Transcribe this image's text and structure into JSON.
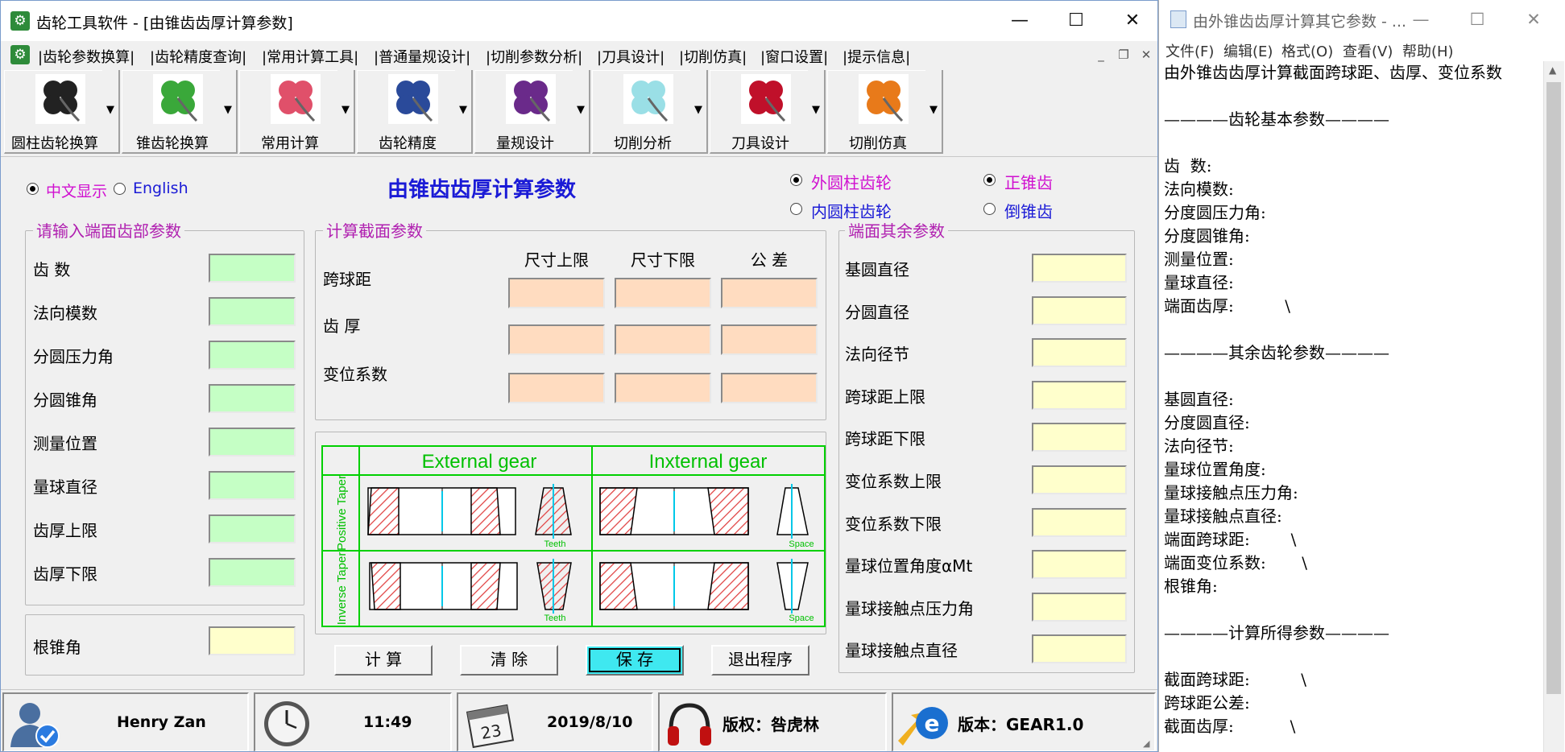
{
  "app": {
    "title": "齿轮工具软件 - [由锥齿齿厚计算参数]",
    "menu": [
      "|齿轮参数换算|",
      "|齿轮精度查询|",
      "|常用计算工具|",
      "|普通量规设计|",
      "|切削参数分析|",
      "|刀具设计|",
      "|切削仿真|",
      "|窗口设置|",
      "|提示信息|"
    ],
    "toolbar": [
      {
        "label": "圆柱齿轮换算",
        "icon": "clover-icon",
        "color": "#222222"
      },
      {
        "label": "锥齿轮换算",
        "icon": "clover-icon",
        "color": "#3aa83a"
      },
      {
        "label": "常用计算",
        "icon": "clover-icon",
        "color": "#e0506a"
      },
      {
        "label": "齿轮精度",
        "icon": "clover-icon",
        "color": "#2a4a9a"
      },
      {
        "label": "量规设计",
        "icon": "clover-icon",
        "color": "#6a2a8a"
      },
      {
        "label": "切削分析",
        "icon": "clover-icon",
        "color": "#9adfe6"
      },
      {
        "label": "刀具设计",
        "icon": "clover-icon",
        "color": "#c0102a"
      },
      {
        "label": "切削仿真",
        "icon": "clover-icon",
        "color": "#e87a1a"
      }
    ],
    "lang": {
      "zh": "中文显示",
      "en": "English"
    },
    "panel_title": "由锥齿齿厚计算参数",
    "gear_type": {
      "ext": "外圆柱齿轮",
      "int": "内圆柱齿轮"
    },
    "taper_type": {
      "pos": "正锥齿",
      "neg": "倒锥齿"
    },
    "left_group": {
      "title": "请输入端面齿部参数",
      "fields": [
        "齿 数",
        "法向模数",
        "分圆压力角",
        "分圆锥角",
        "测量位置",
        "量球直径",
        "齿厚上限",
        "齿厚下限"
      ]
    },
    "root_angle": "根锥角",
    "mid_group": {
      "title": "计算截面参数",
      "cols": [
        "尺寸上限",
        "尺寸下限",
        "公 差"
      ],
      "rows": [
        "跨球距",
        "齿 厚",
        "变位系数"
      ]
    },
    "diagram": {
      "ext": "External gear",
      "int": "Inxternal gear",
      "pos": "Positive Taper",
      "inv": "Inverse Taper",
      "teeth": "Teeth",
      "space": "Space"
    },
    "right_group": {
      "title": "端面其余参数",
      "fields": [
        "基圆直径",
        "分圆直径",
        "法向径节",
        "跨球距上限",
        "跨球距下限",
        "变位系数上限",
        "变位系数下限",
        "量球位置角度αMt",
        "量球接触点压力角",
        "量球接触点直径"
      ]
    },
    "buttons": {
      "calc": "计 算",
      "clear": "清 除",
      "save": "保 存",
      "exit": "退出程序"
    },
    "status": {
      "user": "Henry Zan",
      "time": "11:49",
      "date": "2019/8/10",
      "copyright": "版权：咎虎林",
      "version": "版本：GEAR1.0",
      "calendar_day": "23"
    }
  },
  "notepad": {
    "title": "由外锥齿齿厚计算其它参数 - ...",
    "menu": [
      "文件(F)",
      "编辑(E)",
      "格式(O)",
      "查看(V)",
      "帮助(H)"
    ],
    "lines": [
      "由外锥齿齿厚计算截面跨球距、齿厚、变位系数",
      "",
      "————齿轮基本参数————",
      "",
      "齿  数:",
      "法向模数:",
      "分度圆压力角:",
      "分度圆锥角:",
      "测量位置:",
      "量球直径:",
      "端面齿厚:          \\",
      "",
      "————其余齿轮参数————",
      "",
      "基圆直径:",
      "分度圆直径:",
      "法向径节:",
      "量球位置角度:",
      "量球接触点压力角:",
      "量球接触点直径:",
      "端面跨球距:        \\",
      "端面变位系数:       \\",
      "根锥角:",
      "",
      "————计算所得参数————",
      "",
      "截面跨球距:          \\",
      "跨球距公差:",
      "截面齿厚:           \\"
    ]
  }
}
